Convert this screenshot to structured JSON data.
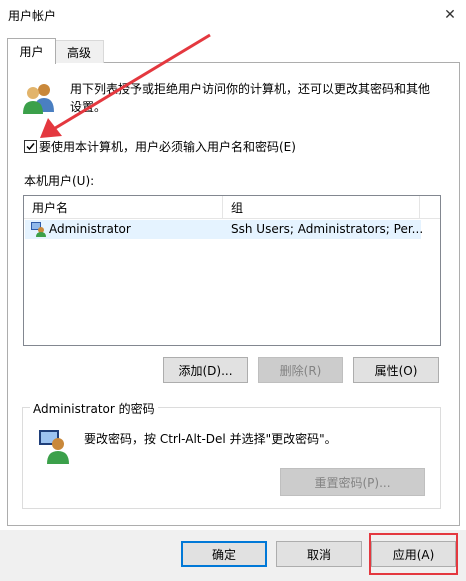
{
  "window": {
    "title": "用户帐户",
    "close_glyph": "✕"
  },
  "tabs": [
    {
      "label": "用户",
      "active": true
    },
    {
      "label": "高级",
      "active": false
    }
  ],
  "intro_text": "用下列表授予或拒绝用户访问你的计算机，还可以更改其密码和其他设置。",
  "require_login": {
    "label": "要使用本计算机，用户必须输入用户名和密码(E)",
    "checked": true
  },
  "users_label": "本机用户(U):",
  "users_table": {
    "columns": [
      "用户名",
      "组"
    ],
    "rows": [
      {
        "name": "Administrator",
        "group": "Ssh Users; Administrators; Per..."
      }
    ]
  },
  "user_buttons": {
    "add": "添加(D)...",
    "delete": "删除(R)",
    "properties": "属性(O)"
  },
  "password_group": {
    "title": "Administrator 的密码",
    "text": "要改密码，按 Ctrl-Alt-Del 并选择\"更改密码\"。",
    "reset_button": "重置密码(P)..."
  },
  "footer": {
    "ok": "确定",
    "cancel": "取消",
    "apply": "应用(A)"
  },
  "annotation": {
    "color": "#e4383f"
  },
  "colors": {
    "selection": "#e5f3ff",
    "focus": "#0078d7"
  }
}
